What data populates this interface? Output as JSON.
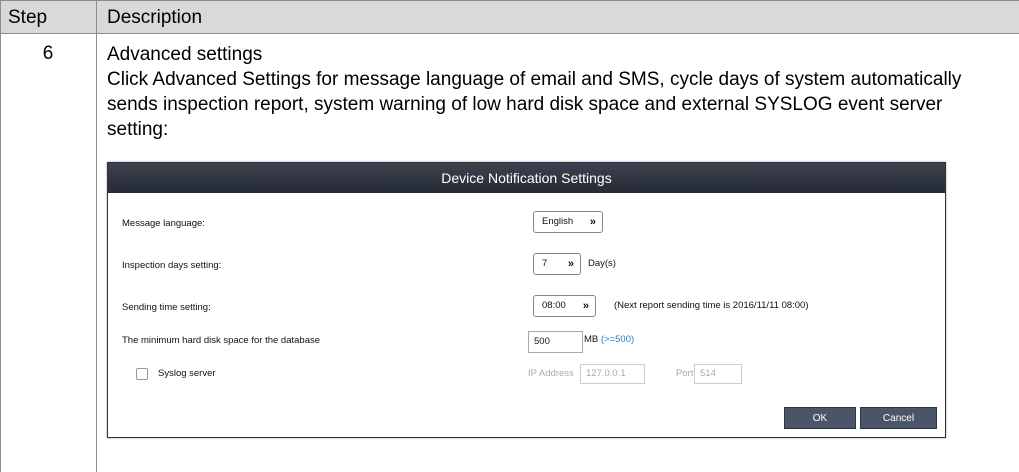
{
  "table": {
    "headers": {
      "step": "Step",
      "description": "Description"
    },
    "row": {
      "step": "6",
      "title": "Advanced settings",
      "text_prefix": "Click ",
      "text_bold": "Advanced Settings",
      "text_suffix": " for message language of email and SMS, cycle days of system automatically sends inspection report, system warning of low hard disk space and external SYSLOG event server setting:"
    }
  },
  "dialog": {
    "title": "Device Notification Settings",
    "message_language": {
      "label": "Message language:",
      "value": "English"
    },
    "inspection_days": {
      "label": "Inspection days setting:",
      "value": "7",
      "unit": "Day(s)"
    },
    "sending_time": {
      "label": "Sending time setting:",
      "value": "08:00",
      "note": "(Next report sending time is 2016/11/11 08:00)"
    },
    "min_disk": {
      "label": "The minimum hard disk space for the database",
      "value": "500",
      "unit": "MB",
      "hint": "(>=500)"
    },
    "syslog": {
      "label": "Syslog server",
      "ip_label": "IP Address",
      "ip_value": "127.0.0.1",
      "port_label": "Port",
      "port_value": "514"
    },
    "buttons": {
      "ok": "OK",
      "cancel": "Cancel"
    }
  },
  "colors": {
    "header_bg": "#d9d9d9",
    "titlebar": "#2e3440",
    "hint": "#2b7bbf",
    "button": "#4a5568"
  }
}
